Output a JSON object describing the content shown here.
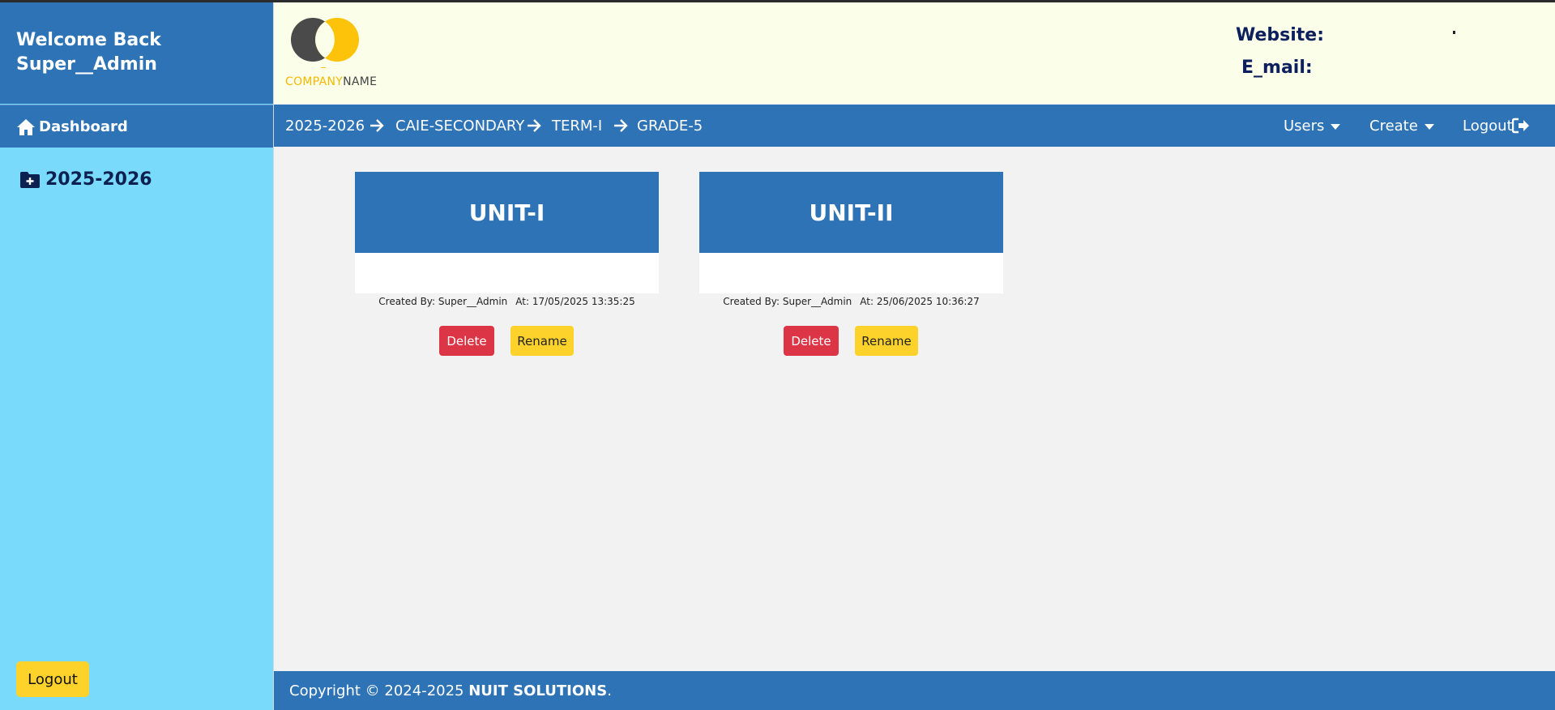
{
  "sidebar": {
    "welcome_line1": "Welcome Back",
    "welcome_line2": "Super__Admin",
    "dashboard_label": "Dashboard",
    "year_label": "2025-2026",
    "logout_label": "Logout"
  },
  "header": {
    "logo": {
      "company_colored": "COMPANY",
      "company_plain": "NAME"
    },
    "website_label": "Website:",
    "email_label": "E_mail:"
  },
  "breadcrumb": [
    "2025-2026",
    "CAIE-SECONDARY",
    "TERM-I",
    "GRADE-5"
  ],
  "nav": {
    "users": "Users",
    "create": "Create",
    "logout": "Logout"
  },
  "units": [
    {
      "title": "UNIT-I",
      "created_by": "Created By: Super__Admin",
      "created_at": "At: 17/05/2025 13:35:25",
      "delete_label": "Delete",
      "rename_label": "Rename"
    },
    {
      "title": "UNIT-II",
      "created_by": "Created By: Super__Admin",
      "created_at": "At: 25/06/2025 10:36:27",
      "delete_label": "Delete",
      "rename_label": "Rename"
    }
  ],
  "footer": {
    "prefix": "Copyright © 2024-2025 ",
    "company": "NUIT SOLUTIONS",
    "suffix": "."
  },
  "colors": {
    "primary": "#2e73b5",
    "sidebar": "#79dafc",
    "header_bg": "#fbfee8",
    "danger": "#dc3545",
    "warning": "#fdd22b",
    "content_bg": "#f2f2f2"
  }
}
